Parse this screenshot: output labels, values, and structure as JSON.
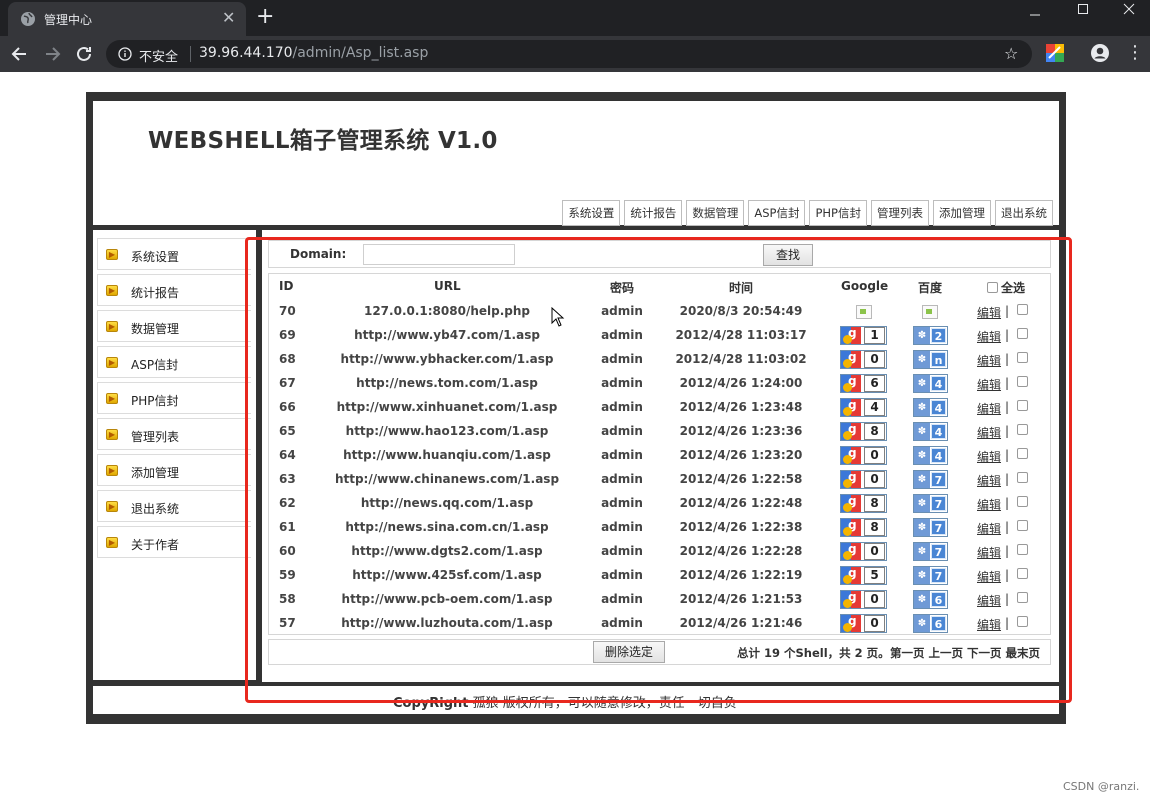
{
  "browser": {
    "tab_title": "管理中心",
    "tab_close": "✕",
    "new_tab": "+",
    "security_label": "不安全",
    "url_host": "39.96.44.170",
    "url_path": "/admin/Asp_list.asp"
  },
  "site": {
    "title": "WEBSHELL箱子管理系统 V1.0",
    "top_nav": [
      "系统设置",
      "统计报告",
      "数据管理",
      "ASP信封",
      "PHP信封",
      "管理列表",
      "添加管理",
      "退出系统"
    ],
    "sidebar": [
      "系统设置",
      "统计报告",
      "数据管理",
      "ASP信封",
      "PHP信封",
      "管理列表",
      "添加管理",
      "退出系统",
      "关于作者"
    ],
    "copyright_bold": "CopyRight",
    "copyright_text": " 孤狼 版权所有，可以随意修改，责任一切自负"
  },
  "search": {
    "label": "Domain:",
    "value": "",
    "button": "查找"
  },
  "table": {
    "headers": {
      "id": "ID",
      "url": "URL",
      "password": "密码",
      "time": "时间",
      "google": "Google",
      "baidu": "百度",
      "select_all": "全选"
    },
    "edit_label": "编辑",
    "separator": "|",
    "rows": [
      {
        "id": "70",
        "url": "127.0.0.1:8080/help.php",
        "password": "admin",
        "time": "2020/8/3 20:54:49",
        "google": null,
        "baidu": null
      },
      {
        "id": "69",
        "url": "http://www.yb47.com/1.asp",
        "password": "admin",
        "time": "2012/4/28 11:03:17",
        "google": "1",
        "baidu": "2"
      },
      {
        "id": "68",
        "url": "http://www.ybhacker.com/1.asp",
        "password": "admin",
        "time": "2012/4/28 11:03:02",
        "google": "0",
        "baidu": "n"
      },
      {
        "id": "67",
        "url": "http://news.tom.com/1.asp",
        "password": "admin",
        "time": "2012/4/26 1:24:00",
        "google": "6",
        "baidu": "4"
      },
      {
        "id": "66",
        "url": "http://www.xinhuanet.com/1.asp",
        "password": "admin",
        "time": "2012/4/26 1:23:48",
        "google": "4",
        "baidu": "4"
      },
      {
        "id": "65",
        "url": "http://www.hao123.com/1.asp",
        "password": "admin",
        "time": "2012/4/26 1:23:36",
        "google": "8",
        "baidu": "4"
      },
      {
        "id": "64",
        "url": "http://www.huanqiu.com/1.asp",
        "password": "admin",
        "time": "2012/4/26 1:23:20",
        "google": "0",
        "baidu": "4"
      },
      {
        "id": "63",
        "url": "http://www.chinanews.com/1.asp",
        "password": "admin",
        "time": "2012/4/26 1:22:58",
        "google": "0",
        "baidu": "7"
      },
      {
        "id": "62",
        "url": "http://news.qq.com/1.asp",
        "password": "admin",
        "time": "2012/4/26 1:22:48",
        "google": "8",
        "baidu": "7"
      },
      {
        "id": "61",
        "url": "http://news.sina.com.cn/1.asp",
        "password": "admin",
        "time": "2012/4/26 1:22:38",
        "google": "8",
        "baidu": "7"
      },
      {
        "id": "60",
        "url": "http://www.dgts2.com/1.asp",
        "password": "admin",
        "time": "2012/4/26 1:22:28",
        "google": "0",
        "baidu": "7"
      },
      {
        "id": "59",
        "url": "http://www.425sf.com/1.asp",
        "password": "admin",
        "time": "2012/4/26 1:22:19",
        "google": "5",
        "baidu": "7"
      },
      {
        "id": "58",
        "url": "http://www.pcb-oem.com/1.asp",
        "password": "admin",
        "time": "2012/4/26 1:21:53",
        "google": "0",
        "baidu": "6"
      },
      {
        "id": "57",
        "url": "http://www.luzhouta.com/1.asp",
        "password": "admin",
        "time": "2012/4/26 1:21:46",
        "google": "0",
        "baidu": "6"
      }
    ]
  },
  "footer_bar": {
    "delete_button": "删除选定",
    "summary": "总计 19 个Shell，共 2 页。",
    "pager": [
      "第一页",
      "上一页",
      "下一页",
      "最末页"
    ]
  },
  "watermark": "CSDN @ranzi."
}
